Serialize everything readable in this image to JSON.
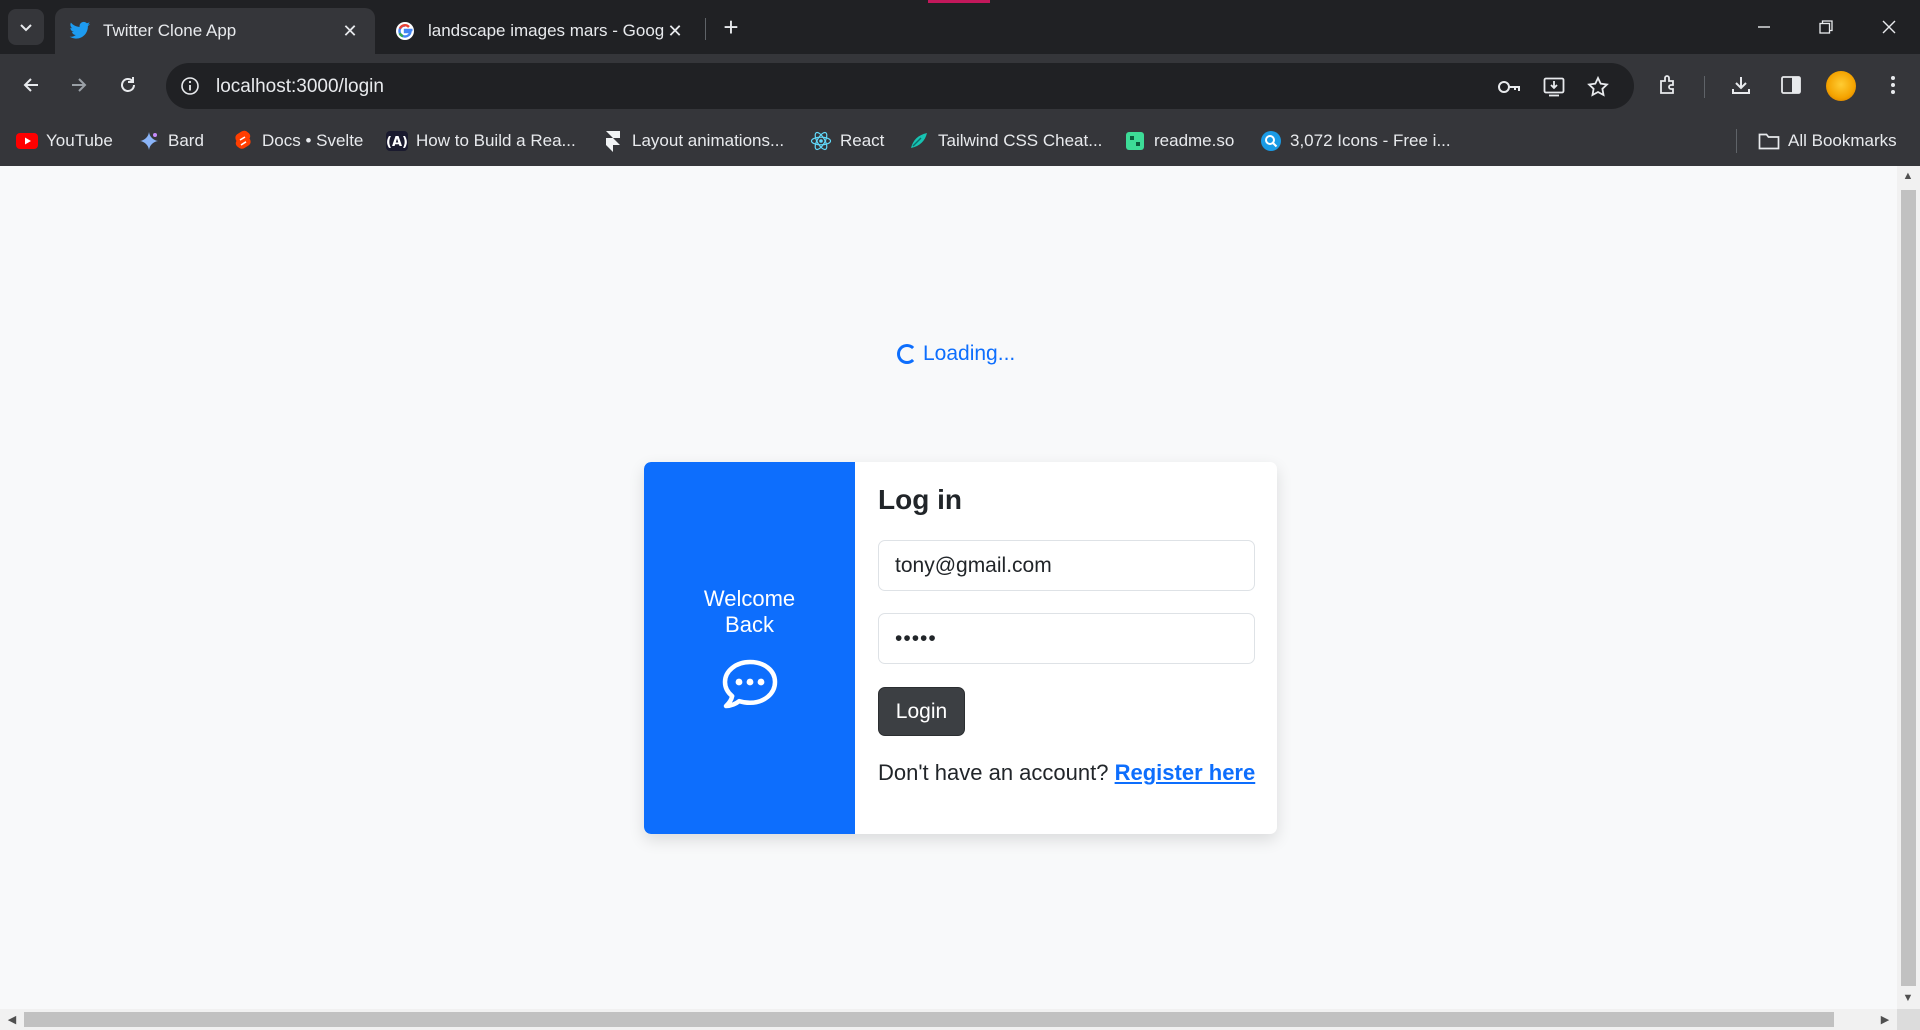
{
  "browser": {
    "tabs": [
      {
        "title": "Twitter Clone App",
        "favicon": "twitter-bird-icon",
        "active": true
      },
      {
        "title": "landscape images mars - Goog",
        "favicon": "google-icon",
        "active": false
      }
    ],
    "address": "localhost:3000/login",
    "bookmarks": [
      {
        "label": "YouTube",
        "icon": "youtube-icon"
      },
      {
        "label": "Bard",
        "icon": "bard-sparkle-icon"
      },
      {
        "label": "Docs • Svelte",
        "icon": "svelte-icon"
      },
      {
        "label": "How to Build a Rea...",
        "icon": "react-build-icon"
      },
      {
        "label": "Layout animations...",
        "icon": "framer-icon"
      },
      {
        "label": "React",
        "icon": "react-icon"
      },
      {
        "label": "Tailwind CSS Cheat...",
        "icon": "tailwind-icon"
      },
      {
        "label": "readme.so",
        "icon": "readme-icon"
      },
      {
        "label": "3,072 Icons - Free i...",
        "icon": "icons-search-icon"
      }
    ],
    "all_bookmarks": "All Bookmarks"
  },
  "page": {
    "loading_text": "Loading...",
    "welcome_text": "Welcome Back",
    "login_title": "Log in",
    "email_value": "tony@gmail.com",
    "password_value": "•••••",
    "login_button": "Login",
    "no_account_text": "Don't have an account?",
    "register_link": "Register here"
  },
  "colors": {
    "primary": "#0d6efd",
    "login_button_bg": "#3c3f43",
    "chrome_dark": "#202124",
    "chrome_toolbar": "#35363a"
  }
}
